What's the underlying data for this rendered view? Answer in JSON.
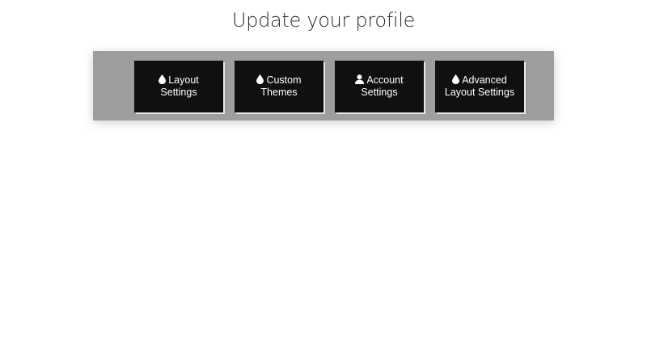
{
  "page": {
    "title": "Update your profile"
  },
  "tiles": [
    {
      "icon": "droplet-icon",
      "line1": "Layout",
      "line2": "Settings"
    },
    {
      "icon": "droplet-icon",
      "line1": "Custom",
      "line2": "Themes"
    },
    {
      "icon": "user-icon",
      "line1": "Account",
      "line2": "Settings"
    },
    {
      "icon": "droplet-icon",
      "line1": "Advanced",
      "line2": "Layout Settings"
    }
  ],
  "colors": {
    "toolbar_bg": "#9e9e9e",
    "tile_bg": "#101010",
    "tile_text": "#ffffff"
  }
}
